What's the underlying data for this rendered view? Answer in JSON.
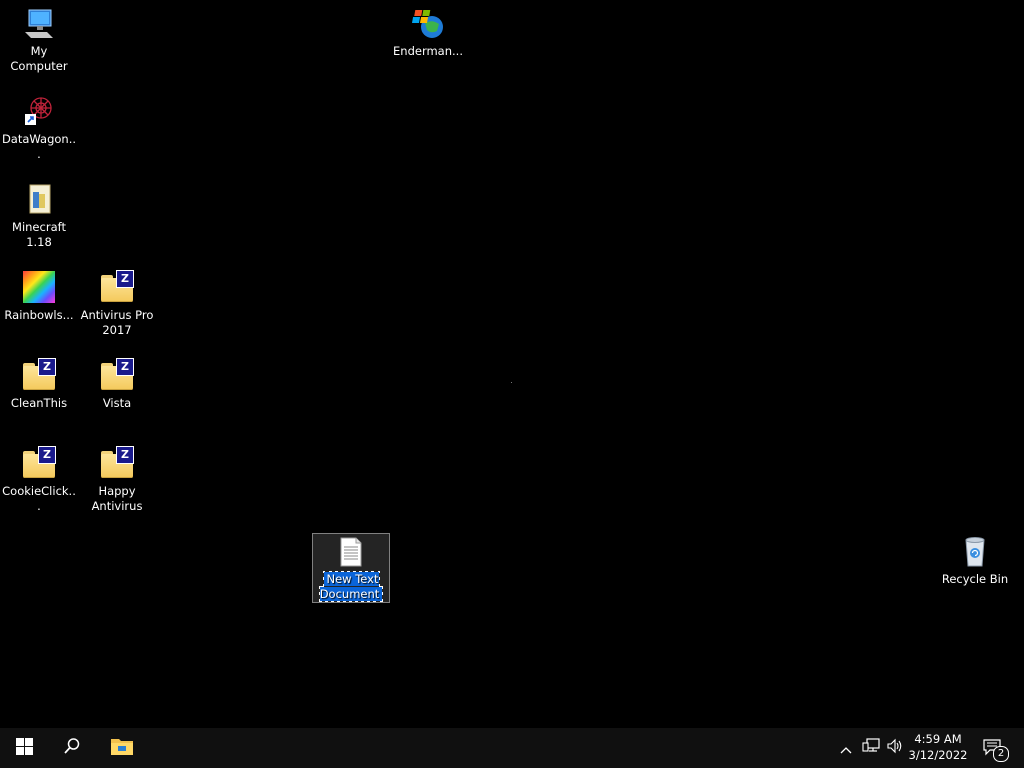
{
  "desktop": {
    "icons": [
      {
        "label": "My Computer",
        "icon": "computer-icon"
      },
      {
        "label": "Enderman...",
        "icon": "windows-globe-icon"
      },
      {
        "label": "DataWagon...",
        "icon": "web-shortcut-icon"
      },
      {
        "label": "Minecraft 1.18",
        "icon": "minecraft-file-icon"
      },
      {
        "label": "Rainbowls...",
        "icon": "rainbow-image-icon"
      },
      {
        "label": "Antivirus Pro 2017",
        "icon": "zip-folder-icon"
      },
      {
        "label": "CleanThis",
        "icon": "zip-folder-icon"
      },
      {
        "label": "Vista",
        "icon": "zip-folder-icon"
      },
      {
        "label": "CookieClick...",
        "icon": "zip-folder-icon"
      },
      {
        "label": "Happy Antivirus",
        "icon": "zip-folder-icon"
      },
      {
        "label": "New Text Document",
        "icon": "text-document-icon",
        "selected": true,
        "renaming": true
      },
      {
        "label": "Recycle Bin",
        "icon": "recycle-bin-icon"
      }
    ]
  },
  "taskbar": {
    "start": {
      "icon": "windows-start-icon"
    },
    "search": {
      "icon": "search-icon"
    },
    "pinned": [
      {
        "icon": "file-explorer-icon"
      }
    ],
    "tray": {
      "chevron": "chevron-up-icon",
      "network": "network-icon",
      "volume": "volume-icon",
      "time": "4:59 AM",
      "date": "3/12/2022",
      "notifications": {
        "icon": "action-center-icon",
        "count": "2"
      }
    }
  },
  "colors": {
    "background": "#000000",
    "taskbar": "#101010",
    "selection": "#0a64d8",
    "folder": "#f4c95b",
    "zip_badge": "#1a1a8c"
  }
}
